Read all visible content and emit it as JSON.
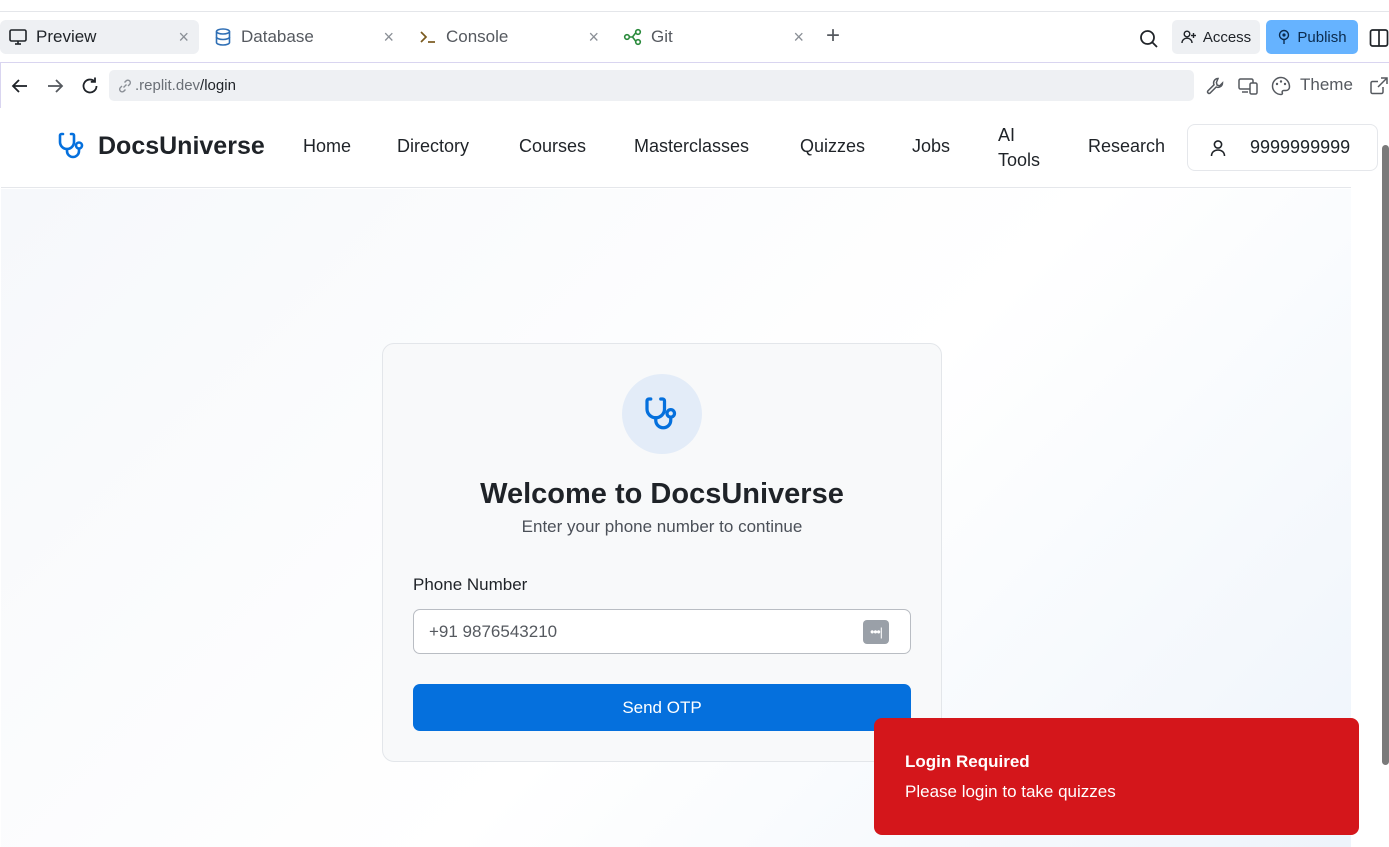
{
  "tabs": [
    {
      "label": "Preview",
      "icon": "monitor-icon",
      "active": true
    },
    {
      "label": "Database",
      "icon": "database-icon",
      "active": false
    },
    {
      "label": "Console",
      "icon": "terminal-icon",
      "active": false
    },
    {
      "label": "Git",
      "icon": "git-icon",
      "active": false
    }
  ],
  "toolbar": {
    "access_label": "Access",
    "publish_label": "Publish"
  },
  "urlbar": {
    "domain": ".replit.dev",
    "path": "/login",
    "theme_label": "Theme"
  },
  "site": {
    "brand": "DocsUniverse",
    "nav": [
      "Home",
      "Directory",
      "Courses",
      "Masterclasses",
      "Quizzes",
      "Jobs",
      "AI",
      "Tools",
      "Research"
    ],
    "user_phone": "9999999999"
  },
  "login": {
    "title": "Welcome to DocsUniverse",
    "subtitle": "Enter your phone number to continue",
    "phone_label": "Phone Number",
    "phone_placeholder": "+91 9876543210",
    "submit_label": "Send OTP"
  },
  "toast": {
    "title": "Login Required",
    "message": "Please login to take quizzes"
  },
  "colors": {
    "brand_blue": "#0570dd",
    "toast_red": "#d4161b",
    "publish_blue": "#66b3ff"
  }
}
